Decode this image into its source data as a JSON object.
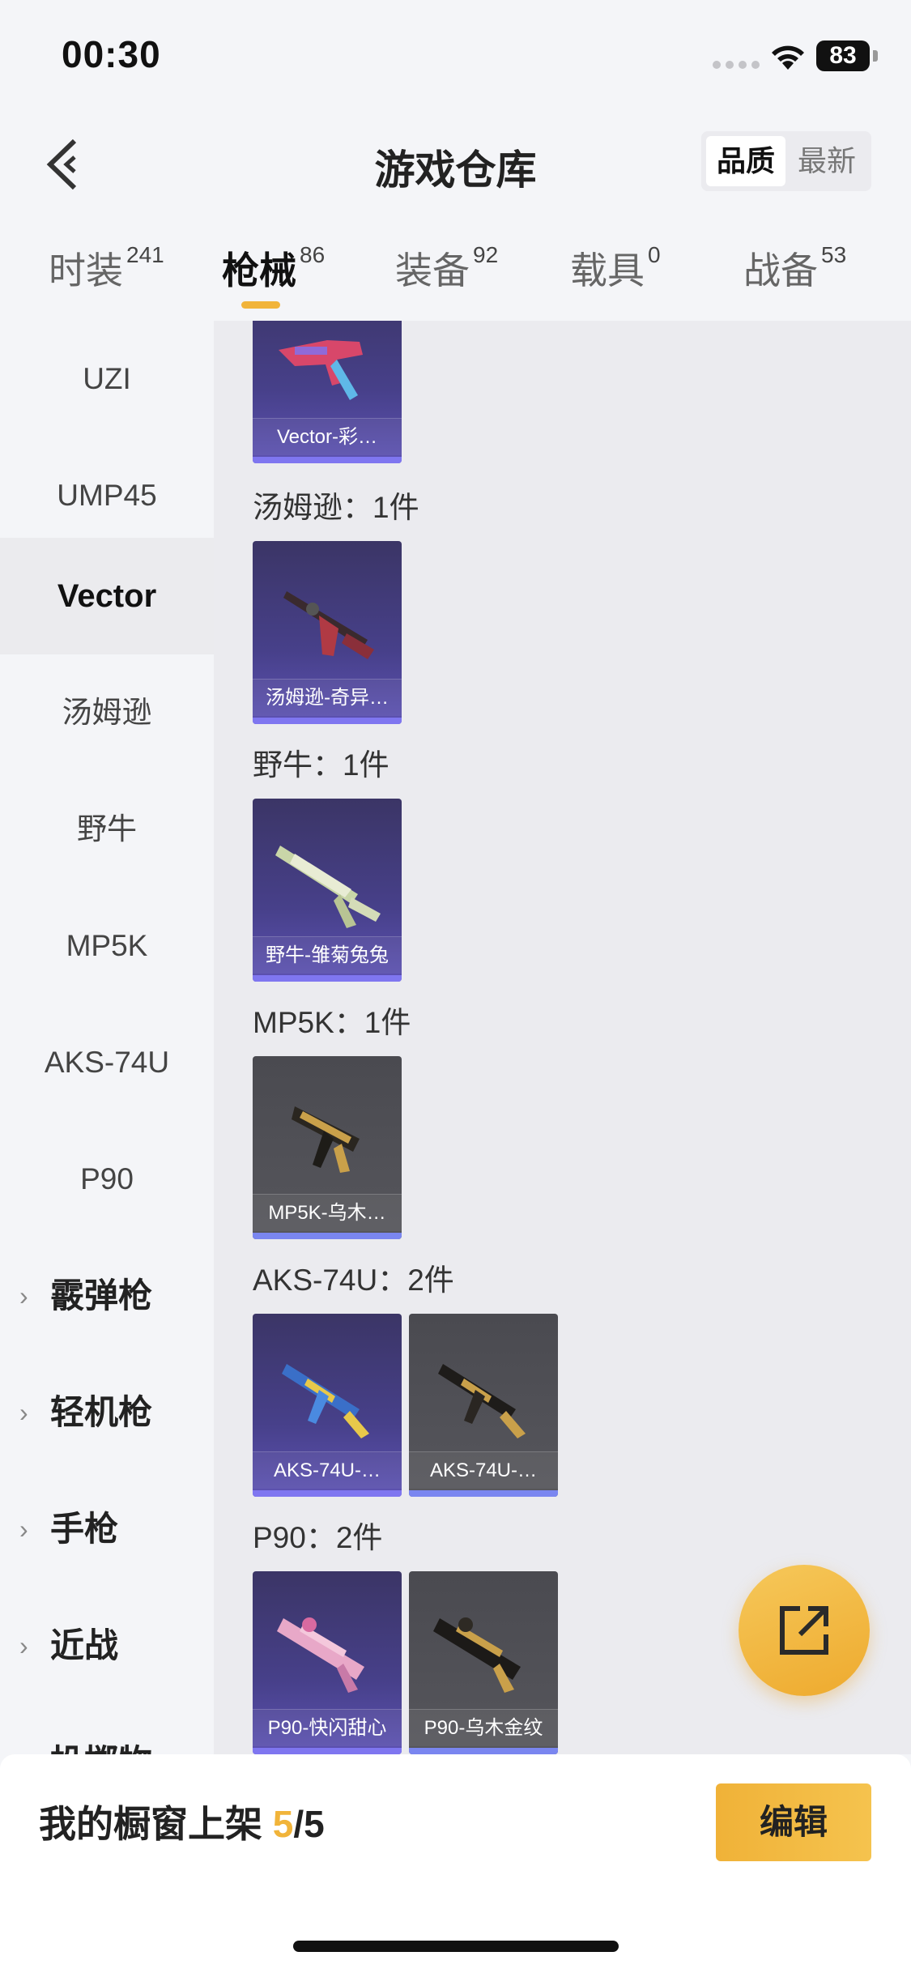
{
  "status": {
    "time": "00:30",
    "battery": "83"
  },
  "header": {
    "title": "游戏仓库",
    "sort_active": "品质",
    "sort_inactive": "最新"
  },
  "tabs": [
    {
      "label": "时装",
      "count": "241"
    },
    {
      "label": "枪械",
      "count": "86"
    },
    {
      "label": "装备",
      "count": "92"
    },
    {
      "label": "载具",
      "count": "0"
    },
    {
      "label": "战备",
      "count": "53"
    }
  ],
  "sidebar": {
    "items": [
      "UZI",
      "UMP45",
      "Vector",
      "汤姆逊",
      "野牛",
      "MP5K",
      "AKS-74U",
      "P90"
    ],
    "active": "Vector",
    "groups": [
      "霰弹枪",
      "轻机枪",
      "手枪",
      "近战"
    ],
    "cut_off_group": "投掷物"
  },
  "content": {
    "top_card_label": "Vector-彩…",
    "groups": [
      {
        "title": "汤姆逊：1件",
        "cards": [
          "汤姆逊-奇异…"
        ]
      },
      {
        "title": "野牛：1件",
        "cards": [
          "野牛-雏菊兔兔"
        ]
      },
      {
        "title": "MP5K：1件",
        "cards": [
          "MP5K-乌木…"
        ]
      },
      {
        "title": "AKS-74U：2件",
        "cards": [
          "AKS-74U-…",
          "AKS-74U-…"
        ]
      },
      {
        "title": "P90：2件",
        "cards": [
          "P90-快闪甜心",
          "P90-乌木金纹"
        ]
      }
    ]
  },
  "fab": {
    "icon": "share-external-icon"
  },
  "bottom": {
    "label": "我的橱窗上架",
    "current": "5",
    "sep_total": "/5",
    "edit": "编辑"
  },
  "colors": {
    "accent": "#f1b43a",
    "card_purple": "#47408a",
    "card_gray": "#525258",
    "bar": "#7f76f0"
  }
}
